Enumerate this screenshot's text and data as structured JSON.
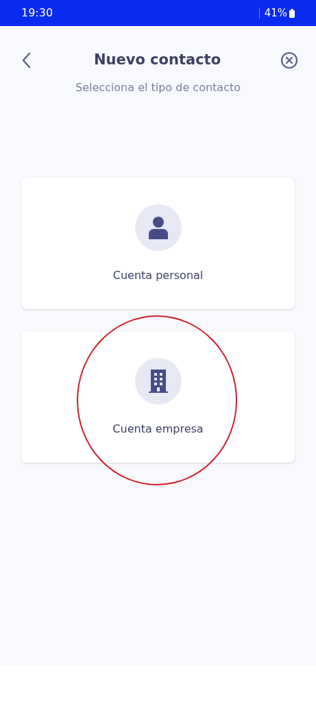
{
  "status_bar": {
    "time": "19:30",
    "battery": "41%"
  },
  "header": {
    "title": "Nuevo contacto",
    "subtitle": "Selecciona el tipo de contacto"
  },
  "options": [
    {
      "kind": "person",
      "label": "Cuenta personal",
      "circled": false
    },
    {
      "kind": "building",
      "label": "Cuenta empresa",
      "circled": true
    }
  ]
}
